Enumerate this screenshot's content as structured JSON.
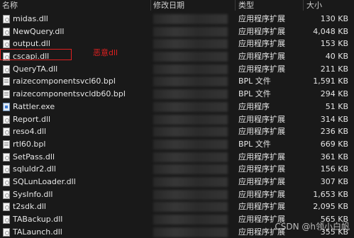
{
  "header": {
    "name": "名称",
    "date": "修改日期",
    "type": "类型",
    "size": "大小"
  },
  "files": [
    {
      "name": "midas.dll",
      "type": "应用程序扩展",
      "size": "130 KB",
      "icon": "dll-file-icon"
    },
    {
      "name": "NewQuery.dll",
      "type": "应用程序扩展",
      "size": "4,048 KB",
      "icon": "dll-file-icon"
    },
    {
      "name": "output.dll",
      "type": "应用程序扩展",
      "size": "153 KB",
      "icon": "dll-file-icon"
    },
    {
      "name": "cscapi.dll",
      "type": "应用程序扩展",
      "size": "40 KB",
      "icon": "dll-file-icon"
    },
    {
      "name": "QueryTA.dll",
      "type": "应用程序扩展",
      "size": "211 KB",
      "icon": "dll-file-icon"
    },
    {
      "name": "raizecomponentsvcl60.bpl",
      "type": "BPL 文件",
      "size": "1,591 KB",
      "icon": "bpl-file-icon"
    },
    {
      "name": "raizecomponentsvcldb60.bpl",
      "type": "BPL 文件",
      "size": "294 KB",
      "icon": "bpl-file-icon"
    },
    {
      "name": "Rattler.exe",
      "type": "应用程序",
      "size": "51 KB",
      "icon": "exe-file-icon"
    },
    {
      "name": "Report.dll",
      "type": "应用程序扩展",
      "size": "314 KB",
      "icon": "dll-file-icon"
    },
    {
      "name": "reso4.dll",
      "type": "应用程序扩展",
      "size": "236 KB",
      "icon": "dll-file-icon"
    },
    {
      "name": "rtl60.bpl",
      "type": "BPL 文件",
      "size": "669 KB",
      "icon": "bpl-file-icon"
    },
    {
      "name": "SetPass.dll",
      "type": "应用程序扩展",
      "size": "361 KB",
      "icon": "dll-file-icon"
    },
    {
      "name": "sqluldr2.dll",
      "type": "应用程序扩展",
      "size": "156 KB",
      "icon": "dll-file-icon"
    },
    {
      "name": "SQLunLoader.dll",
      "type": "应用程序扩展",
      "size": "307 KB",
      "icon": "dll-file-icon"
    },
    {
      "name": "SysInfo.dll",
      "type": "应用程序扩展",
      "size": "1,653 KB",
      "icon": "dll-file-icon"
    },
    {
      "name": "t2sdk.dll",
      "type": "应用程序扩展",
      "size": "2,095 KB",
      "icon": "dll-file-icon"
    },
    {
      "name": "TABackup.dll",
      "type": "应用程序扩展",
      "size": "565 KB",
      "icon": "dll-file-icon"
    },
    {
      "name": "TALaunch.dll",
      "type": "应用程序扩展",
      "size": "355 KB",
      "icon": "dll-file-icon"
    }
  ],
  "annotation": "恶意dll",
  "watermark": "CSDN @h领小白帆"
}
